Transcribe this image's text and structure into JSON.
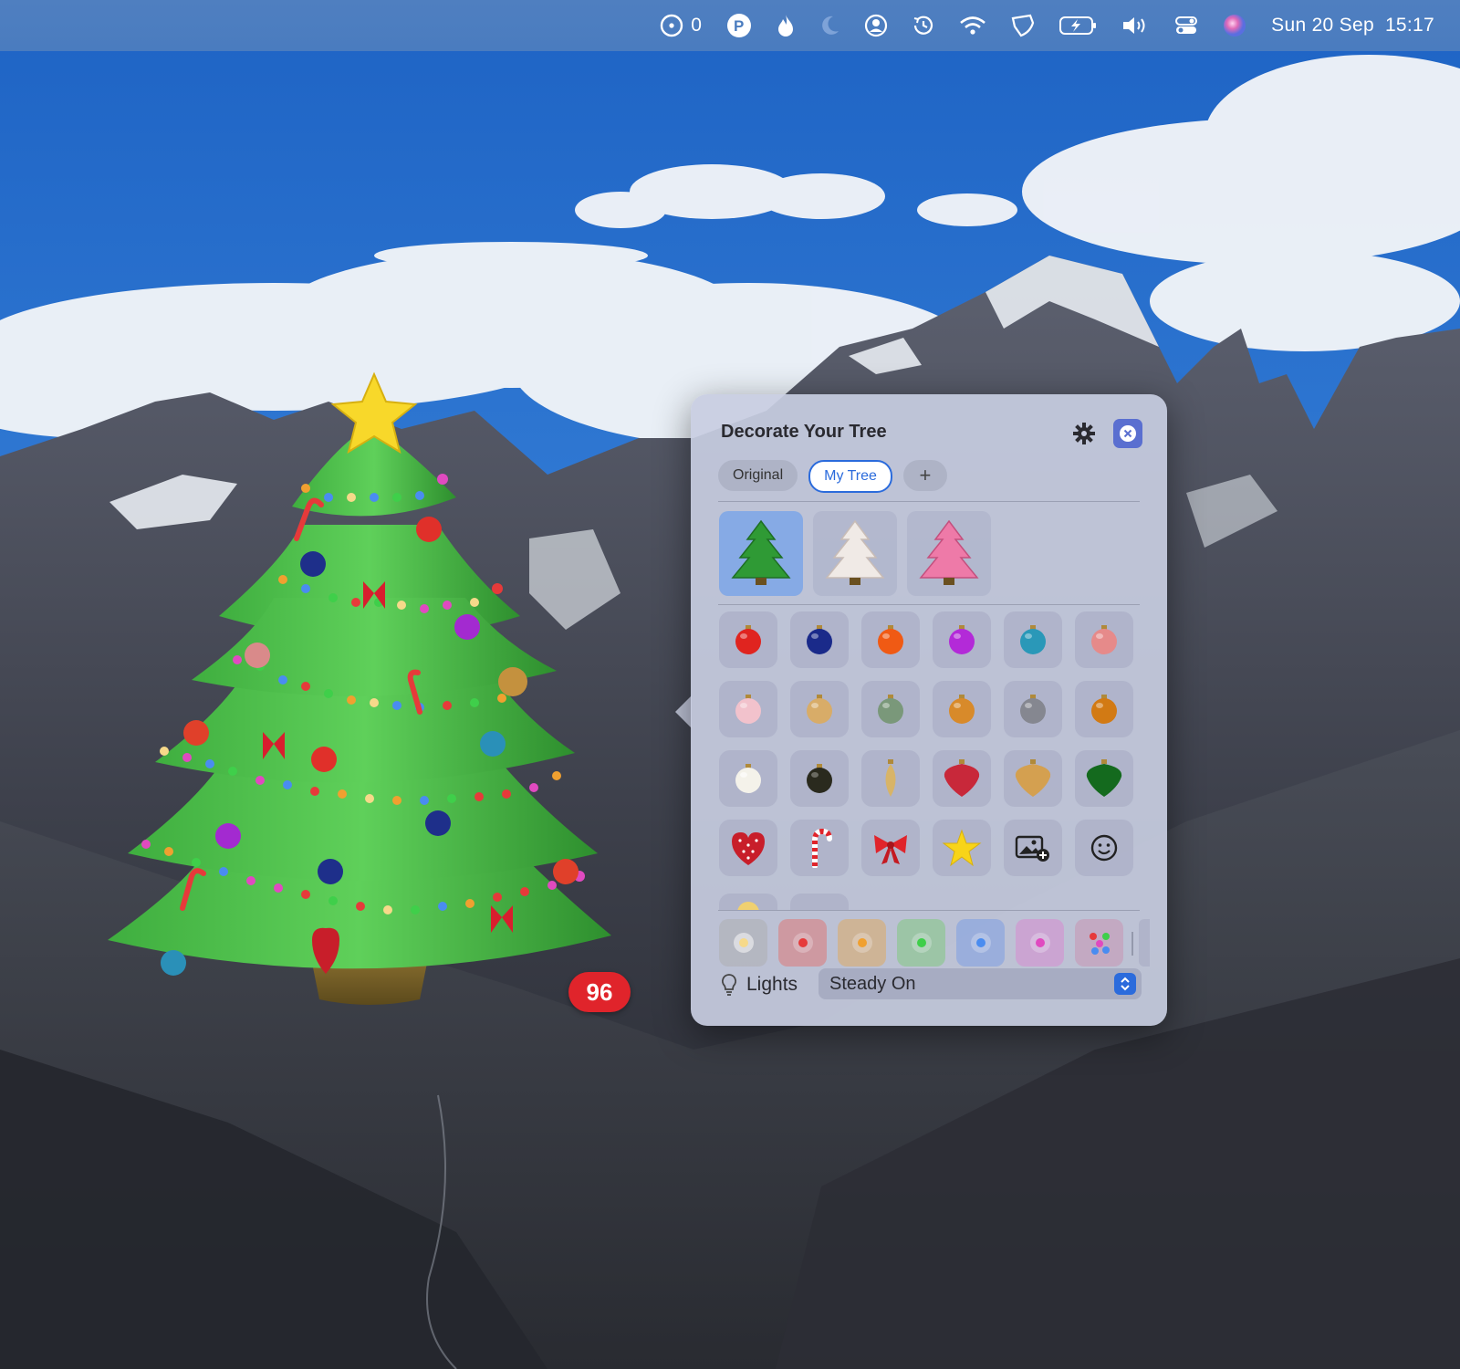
{
  "menubar": {
    "counter_value": "0",
    "date": "Sun 20 Sep",
    "time": "15:17",
    "icons": [
      "clock-timer-icon",
      "p-app-icon",
      "flame-icon",
      "moon-icon",
      "user-circle-icon",
      "history-icon",
      "wifi-icon",
      "shield-icon",
      "battery-charging-icon",
      "volume-icon",
      "control-center-icon",
      "siri-icon"
    ]
  },
  "tree": {
    "ornament_count": "96"
  },
  "panel": {
    "title": "Decorate Your Tree",
    "tabs": [
      {
        "label": "Original",
        "active": false
      },
      {
        "label": "My Tree",
        "active": true
      }
    ],
    "add_tab_label": "+",
    "tree_styles": [
      {
        "name": "green-tree",
        "selected": true
      },
      {
        "name": "white-tree",
        "selected": false
      },
      {
        "name": "pink-tree",
        "selected": false
      }
    ],
    "ornaments": [
      [
        "red-ball",
        "navy-ball",
        "orange-ball",
        "purple-ball",
        "teal-ball",
        "rose-ball"
      ],
      [
        "pink-ball",
        "tan-ball",
        "sage-ball",
        "amber-ball",
        "gray-ball",
        "copper-ball"
      ],
      [
        "white-ball",
        "black-ball",
        "gold-drop",
        "red-heart-drop",
        "gold-heart-drop",
        "green-heart-drop"
      ],
      [
        "polka-heart",
        "candy-cane",
        "red-bow",
        "gold-star",
        "add-photo-icon",
        "emoji-icon"
      ]
    ],
    "light_colors": [
      "#f6d98a",
      "#e63a3a",
      "#f0a030",
      "#3fcf4a",
      "#4a8cf0",
      "#e04ac0",
      "multicolor"
    ],
    "lights_label": "Lights",
    "lights_mode": "Steady On"
  },
  "colors": {
    "accent": "#2b6bdc",
    "badge": "#e0242b",
    "menubar": "#4a7cbf"
  }
}
